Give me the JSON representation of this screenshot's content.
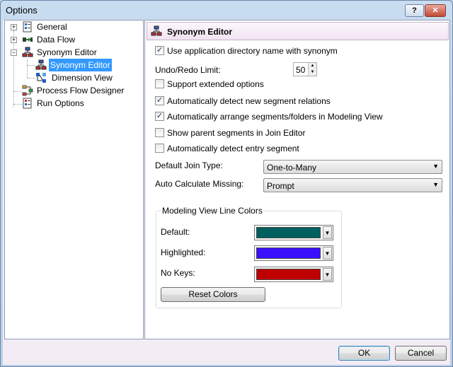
{
  "window": {
    "title": "Options",
    "help_label": "?",
    "close_label": "✕"
  },
  "tree": {
    "items": [
      {
        "label": "General",
        "icon": "general-icon",
        "expander": "+"
      },
      {
        "label": "Data Flow",
        "icon": "data-flow-icon",
        "expander": "+"
      },
      {
        "label": "Synonym Editor",
        "icon": "synonym-editor-icon",
        "expander": "−"
      },
      {
        "label": "Synonym Editor",
        "icon": "synonym-editor-icon",
        "selected": true
      },
      {
        "label": "Dimension View",
        "icon": "dimension-view-icon"
      },
      {
        "label": "Process Flow Designer",
        "icon": "process-flow-icon"
      },
      {
        "label": "Run Options",
        "icon": "run-options-icon"
      }
    ]
  },
  "panel": {
    "title": "Synonym Editor",
    "options": {
      "use_app_dir": {
        "label": "Use application directory name with synonym",
        "checked": true
      },
      "support_extended": {
        "label": "Support extended options",
        "checked": false
      },
      "auto_detect_relations": {
        "label": "Automatically detect new segment relations",
        "checked": true
      },
      "auto_arrange": {
        "label": "Automatically arrange segments/folders in Modeling View",
        "checked": true
      },
      "show_parent": {
        "label": "Show parent segments in Join Editor",
        "checked": false
      },
      "auto_detect_entry": {
        "label": "Automatically detect entry segment",
        "checked": false
      }
    },
    "undo_redo": {
      "label": "Undo/Redo Limit:",
      "value": "50"
    },
    "join_type": {
      "label": "Default Join Type:",
      "value": "One-to-Many"
    },
    "auto_calc": {
      "label": "Auto Calculate Missing:",
      "value": "Prompt"
    },
    "line_colors": {
      "title": "Modeling View Line Colors",
      "default": {
        "label": "Default:",
        "color": "#006060"
      },
      "highlighted": {
        "label": "Highlighted:",
        "color": "#3b10ff"
      },
      "no_keys": {
        "label": "No Keys:",
        "color": "#c00000"
      },
      "reset_label": "Reset Colors"
    }
  },
  "footer": {
    "ok_label": "OK",
    "cancel_label": "Cancel"
  }
}
